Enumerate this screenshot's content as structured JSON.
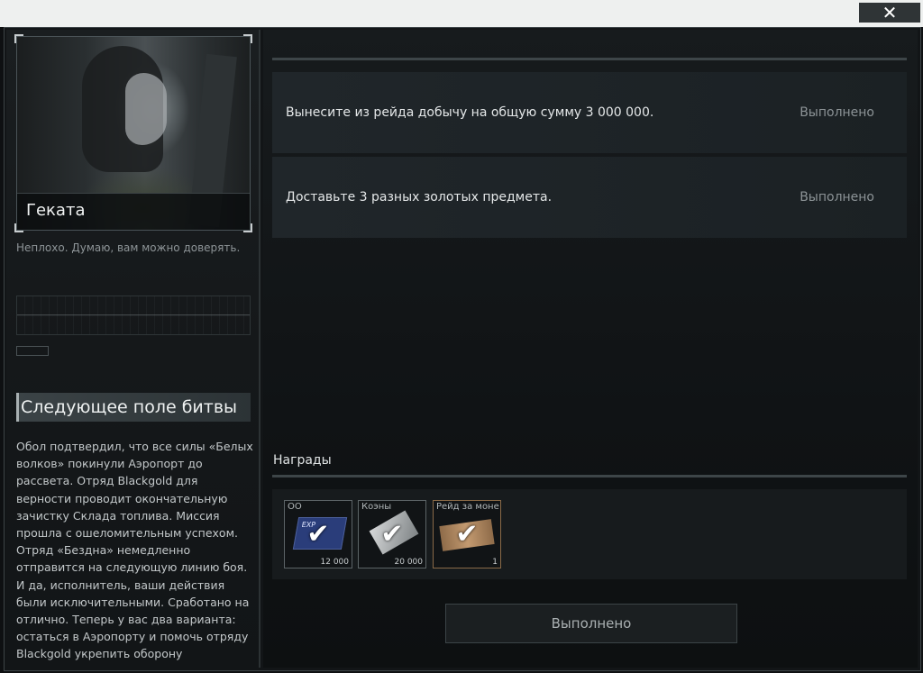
{
  "window": {
    "close_label": "✕"
  },
  "trader": {
    "name": "Геката",
    "quote": "Неплохо. Думаю, вам можно доверять."
  },
  "quest": {
    "title": "Следующее поле битвы",
    "description": "Обол подтвердил, что все силы «Белых волков» покинули Аэропорт до рассвета. Отряд Blackgold для верности проводит окончательную зачистку Склада топлива. Миссия прошла с ошеломительным успехом. Отряд «Бездна» немедленно отправится на следующую линию боя. И да, исполнитель, ваши действия были исключительными. Сработано на отлично. Теперь у вас два варианта: остаться в Аэропорту и помочь отряду Blackgold укрепить оборону"
  },
  "objectives": [
    {
      "text": "Вынесите из рейда добычу на общую сумму 3 000 000.",
      "status": "Выполнено"
    },
    {
      "text": "Доставьте 3 разных золотых предмета.",
      "status": "Выполнено"
    }
  ],
  "rewards": {
    "label": "Награды",
    "items": [
      {
        "name": "ОО",
        "count": "12 000",
        "art_text": "EXP",
        "icon": "experience-card-icon"
      },
      {
        "name": "Коэны",
        "count": "20 000",
        "icon": "koens-currency-icon"
      },
      {
        "name": "Рейд за монеты",
        "count": "1",
        "icon": "raid-ticket-icon"
      }
    ]
  },
  "complete_button": "Выполнено"
}
